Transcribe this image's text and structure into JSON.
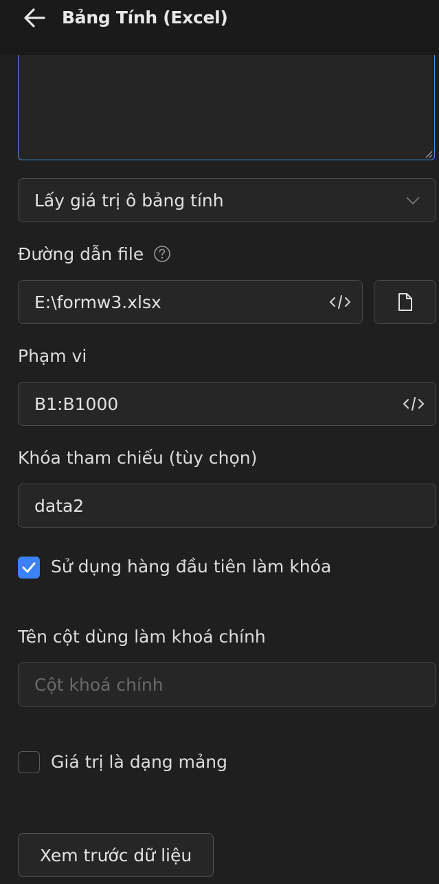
{
  "header": {
    "title": "Bảng Tính (Excel)"
  },
  "action_select": {
    "value": "Lấy giá trị ô bảng tính"
  },
  "file_path": {
    "label": "Đường dẫn file",
    "value": "E:\\formw3.xlsx"
  },
  "range": {
    "label": "Phạm vi",
    "value": "B1:B1000"
  },
  "reference_key": {
    "label": "Khóa tham chiếu (tùy chọn)",
    "value": "data2"
  },
  "first_row_key": {
    "label": "Sử dụng hàng đầu tiên làm khóa",
    "checked": true
  },
  "primary_key_column": {
    "label": "Tên cột dùng làm khoá chính",
    "placeholder": "Cột khoá chính"
  },
  "array_value": {
    "label": "Giá trị là dạng mảng",
    "checked": false
  },
  "preview_button": {
    "label": "Xem trước dữ liệu"
  },
  "icons": [
    "back-arrow-icon",
    "chevron-down-icon",
    "help-circle-icon",
    "code-icon",
    "file-icon",
    "checkmark-icon",
    "resize-grip-icon"
  ],
  "colors": {
    "accent": "#3b82f6",
    "background": "#1f1f1f",
    "field_bg": "#262626",
    "border": "#4a4a4a"
  }
}
